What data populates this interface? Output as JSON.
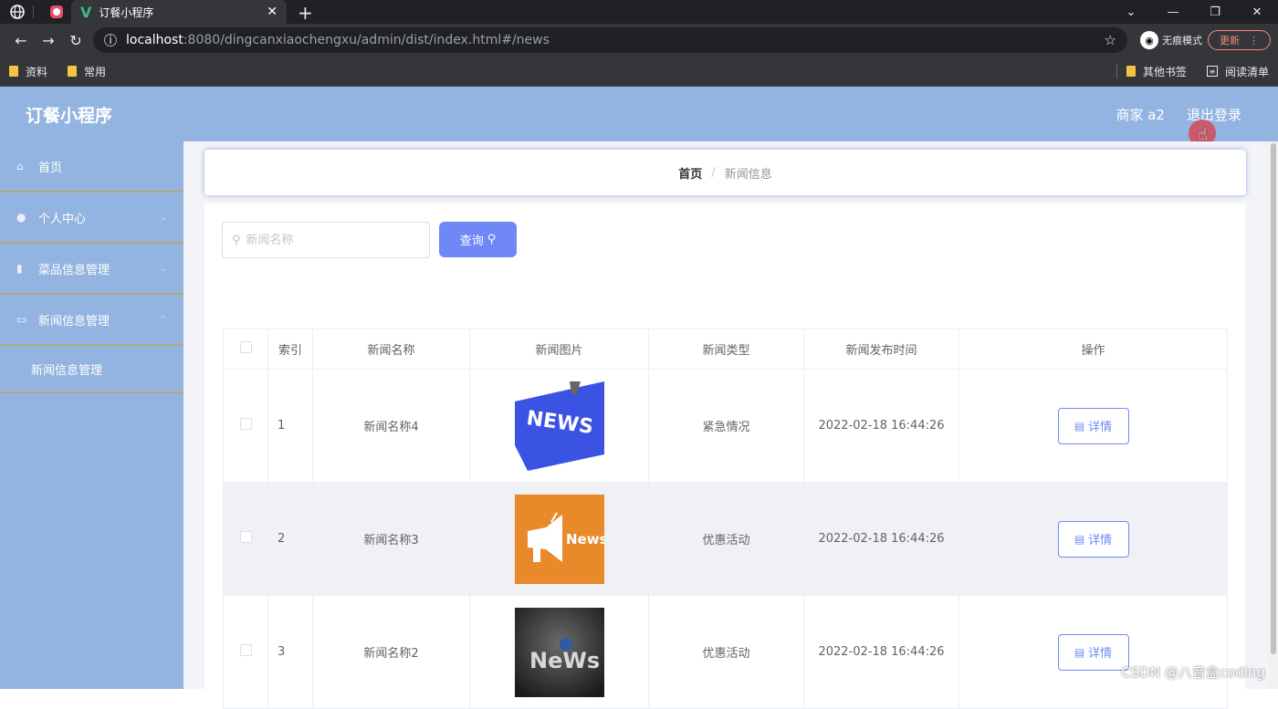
{
  "browser": {
    "tab_title": "订餐小程序",
    "url_host": "localhost",
    "url_rest": ":8080/dingcanxiaochengxu/admin/dist/index.html#/news",
    "incognito_label": "无痕模式",
    "update_label": "更新",
    "bookmarks": [
      "资料",
      "常用"
    ],
    "other_bookmarks": "其他书签",
    "reading_list": "阅读清单"
  },
  "header": {
    "title": "订餐小程序",
    "user": "商家 a2",
    "logout": "退出登录"
  },
  "sidebar": {
    "items": [
      {
        "label": "首页",
        "icon": "home-icon"
      },
      {
        "label": "个人中心",
        "icon": "user-icon"
      },
      {
        "label": "菜品信息管理",
        "icon": "dish-icon"
      },
      {
        "label": "新闻信息管理",
        "icon": "news-icon"
      }
    ],
    "submenu": "新闻信息管理"
  },
  "breadcrumb": {
    "home": "首页",
    "sep": "/",
    "current": "新闻信息"
  },
  "search": {
    "placeholder": "新闻名称",
    "button": "查询"
  },
  "table": {
    "headers": [
      "索引",
      "新闻名称",
      "新闻图片",
      "新闻类型",
      "新闻发布时间",
      "操作"
    ],
    "rows": [
      {
        "index": "1",
        "name": "新闻名称4",
        "image": "NEWS",
        "type": "紧急情况",
        "time": "2022-02-18 16:44:26",
        "action": "详情"
      },
      {
        "index": "2",
        "name": "新闻名称3",
        "image": "News",
        "type": "优惠活动",
        "time": "2022-02-18 16:44:26",
        "action": "详情"
      },
      {
        "index": "3",
        "name": "新闻名称2",
        "image": "NeWs",
        "type": "优惠活动",
        "time": "2022-02-18 16:44:26",
        "action": "详情"
      }
    ]
  },
  "watermark": "CSDN @八音盒coding",
  "colors": {
    "header_bg": "#93b4e0",
    "primary": "#6f87f7",
    "sidebar_divider": "#b9a77a"
  }
}
